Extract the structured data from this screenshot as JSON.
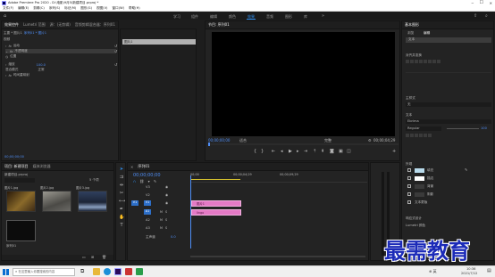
{
  "titlebar": {
    "title": "Adobe Premiere Pro 2020 - D:\\电影\\9月5\\新建项目.prproj *",
    "minimize": "─",
    "maximize": "☐",
    "close": "✕"
  },
  "menubar": {
    "items": [
      "文件(F)",
      "编辑(E)",
      "剪辑(C)",
      "序列(S)",
      "标记(M)",
      "图形(G)",
      "视图(V)",
      "窗口(W)",
      "帮助(H)"
    ]
  },
  "workspaces": {
    "items": [
      "学习",
      "组件",
      "编辑",
      "颜色",
      "效果",
      "音频",
      "图形",
      "库"
    ],
    "active_index": 4,
    "more": "»"
  },
  "effect_controls": {
    "tabs": [
      "效果控件",
      "Lumetri 范围",
      "源：(无剪辑)",
      "音频剪辑混合器：序列01"
    ],
    "active_tab": 0,
    "source": "主要 * 图片1",
    "clip": "序列01 * 图片1",
    "video_header": "视频",
    "rows": [
      {
        "label": "运动",
        "indent": 1
      },
      {
        "label": "不透明度",
        "indent": 1
      },
      {
        "label": "混合模式",
        "value": "正常",
        "indent": 2
      },
      {
        "label": "时间重映射",
        "indent": 1
      },
      {
        "label": "位置",
        "indent": 2
      },
      {
        "label": "缩放",
        "value": "100.0",
        "indent": 2
      }
    ],
    "clip_bar_label": "图片1",
    "timecode": "00;00;00;00"
  },
  "program_monitor": {
    "tab": "节目: 序列01",
    "timecode_left": "00;00;00;00",
    "fit": "适合",
    "quality": "完整",
    "timecode_right": "00;00;04;29"
  },
  "project": {
    "tabs": [
      "项目: 新建项目",
      "媒体浏览器"
    ],
    "active_tab": 0,
    "project_name": "新建项目.prproj",
    "search_placeholder": "",
    "item_count": "5 个项",
    "items": [
      {
        "name": "图片1.jpg",
        "duration": "4;29",
        "color": "#3c2a16"
      },
      {
        "name": "图片2.jpg",
        "duration": "4;29",
        "color": "#6b6a66"
      },
      {
        "name": "图片3.jpg",
        "duration": "4;29",
        "color": "#1c2436"
      },
      {
        "name": "序列01",
        "duration": "4;29",
        "color": "#0c0c0c"
      }
    ]
  },
  "timeline": {
    "tabs": [
      "序列01"
    ],
    "timecode": "00;00;00;00",
    "ruler": [
      "00;00",
      "00;00;04;29",
      "00;00;09;29"
    ],
    "video_tracks": [
      "V3",
      "V2",
      "V1"
    ],
    "audio_tracks": [
      "A1",
      "A2",
      "A3"
    ],
    "master_label": "主声道",
    "master_value": "0.0",
    "clip_label": "图片1",
    "clip_label_2": "lingo"
  },
  "essential_graphics": {
    "tab": "基本图形",
    "subtabs": [
      "浏览",
      "编辑"
    ],
    "layer_label": "文本",
    "align_label": "对齐并变换",
    "styles_label": "主样式",
    "styles_value": "无",
    "text_label": "文本",
    "font": "Ebrima",
    "font_style": "Regular",
    "font_size": "100",
    "appearance_label": "外观",
    "appearance_items": [
      {
        "label": "填充",
        "color": "#b9dbec"
      },
      {
        "label": "描边",
        "color": "#ffffff"
      },
      {
        "label": "背景",
        "color": "#3a3a3a"
      },
      {
        "label": "阴影",
        "color": "#3a3a3a"
      }
    ],
    "text_mask": "文本蒙版",
    "responsive_label": "响应式设计",
    "responsive_sub": "Lumetri 颜色"
  },
  "watermark": {
    "text": "最需教育"
  },
  "taskbar": {
    "search_placeholder": "在这里输入你要搜索的内容",
    "time": "10:36",
    "date": "2021/7/12",
    "tray": "⊕ 英"
  },
  "colors": {
    "accent": "#2d8ceb",
    "clip_pink": "#e47ac5",
    "timeline_yellow": "#d6c12e",
    "playhead": "#4e8df5"
  }
}
